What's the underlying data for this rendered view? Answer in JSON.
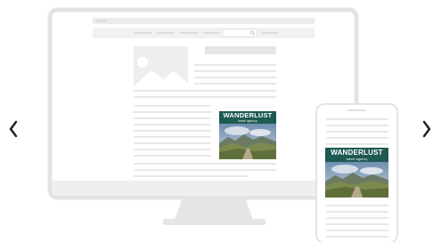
{
  "carousel": {
    "prev_glyph": "‹",
    "next_glyph": "›",
    "prev_icon": "chevron-left-icon",
    "next_icon": "chevron-right-icon"
  },
  "ad": {
    "title": "WANDERLUST",
    "subtitle": "travel agency"
  },
  "mockup": {
    "desktop_icon": "desktop-monitor-icon",
    "mobile_icon": "smartphone-icon",
    "search_icon": "search-icon",
    "image_placeholder_icon": "image-placeholder-icon"
  },
  "colors": {
    "frame_fill": "#ffffff",
    "frame_stroke": "#e4e4e4",
    "text_line": "#e6e6e6",
    "stand": "#e7e7e7",
    "ad_banner": "#1f5a52",
    "arrow": "#1e1e1e"
  }
}
